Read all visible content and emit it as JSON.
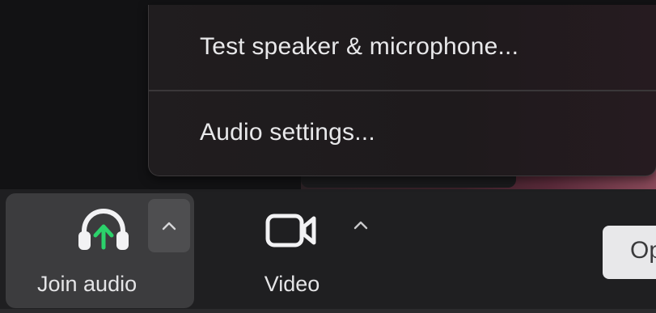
{
  "menu": {
    "items": [
      {
        "label": "Test speaker & microphone..."
      },
      {
        "label": "Audio settings..."
      }
    ]
  },
  "toolbar": {
    "join_audio": {
      "label": "Join audio",
      "icon": "headphones-icon",
      "badge_icon": "arrow-up-icon",
      "badge_color": "#2bd26b"
    },
    "video": {
      "label": "Video",
      "icon": "video-camera-icon"
    },
    "audio_options_icon": "chevron-up-icon",
    "video_options_icon": "chevron-up-icon",
    "partial_button_label": "Op"
  },
  "colors": {
    "background": "#121214",
    "toolbar": "#1f1f21",
    "active_button": "#3c3c3e",
    "menu_text": "#e8e8ea",
    "accent_green": "#2bd26b"
  }
}
